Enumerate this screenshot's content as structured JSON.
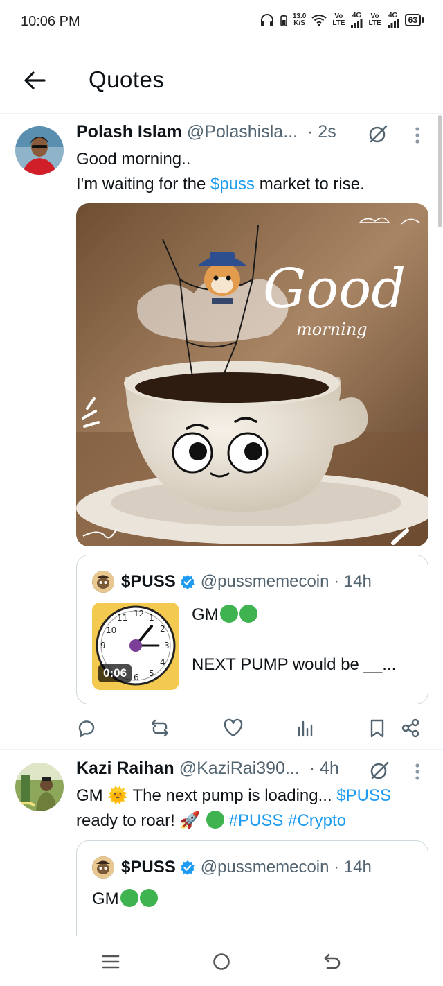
{
  "status_bar": {
    "time": "10:06 PM",
    "net_speed": "13.0",
    "net_unit": "K/S",
    "sim1_vo": "Vo",
    "sim1_lte": "LTE",
    "sim1_4g": "4G",
    "sim2_vo": "Vo",
    "sim2_lte": "LTE",
    "sim2_4g": "4G",
    "battery": "63"
  },
  "header": {
    "title": "Quotes"
  },
  "tweets": [
    {
      "name": "Polash Islam",
      "handle": "@Polashisla...",
      "time": "· 2s",
      "text_line1": "Good morning..",
      "text_line2_pre": "I'm waiting for the ",
      "text_line2_link": "$puss",
      "text_line2_post": " market to rise.",
      "media": {
        "word1": "Good",
        "word2": "morning"
      },
      "quote": {
        "name": "$PUSS",
        "handle": "@pussmemecoin · 14h",
        "text_line1": "GM",
        "text_line2": "NEXT PUMP would be __...",
        "video_duration": "0:06"
      }
    },
    {
      "name": "Kazi Raihan",
      "handle": "@KaziRai390...",
      "time": "· 4h",
      "text_line1_pre": "GM ",
      "text_line1_emoji": "🌞",
      "text_line1_mid": " The next pump is loading... ",
      "text_line1_link": "$PUSS",
      "text_line2_pre": "ready to roar! ",
      "text_line2_emoji": "🚀",
      "text_line2_link": "#PUSS #Crypto",
      "quote": {
        "name": "$PUSS",
        "handle": "@pussmemecoin · 14h",
        "text_line1": "GM"
      }
    }
  ],
  "colors": {
    "link": "#1d9bf0",
    "secondary_text": "#536471",
    "green_circle": "#3fb34f",
    "verified": "#1d9bf0"
  }
}
